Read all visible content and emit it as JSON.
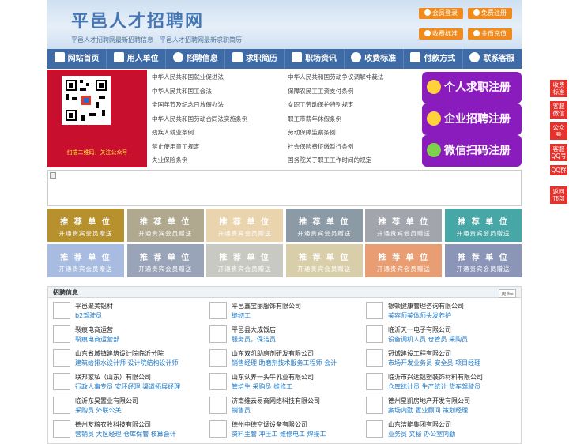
{
  "header": {
    "title": "平邑人才招聘网",
    "subtitle": "平邑人才招聘网最新招聘信息　平邑人才招聘网最新求职简历",
    "buttons": [
      "会员登录",
      "免费注册",
      "收费标准",
      "金币充值"
    ]
  },
  "nav": [
    "网站首页",
    "用人单位",
    "招聘信息",
    "求职简历",
    "职场资讯",
    "收费标准",
    "付款方式",
    "联系客服"
  ],
  "qr": {
    "caption": "扫描二维码，关注公众号"
  },
  "law_links": [
    "中华人民共和国就业促进法",
    "中华人民共和国劳动争议调解仲裁法",
    "中华人民共和国工会法",
    "保障农民工工资支付条例",
    "全国年节及纪念日放假办法",
    "女职工劳动保护特别规定",
    "中华人民共和国劳动合同法实施条例",
    "职工带薪年休假条例",
    "残疾人就业条例",
    "劳动保障监察条例",
    "禁止使用童工规定",
    "社会保险费征缴暂行条例",
    "失业保险条例",
    "国务院关于职工工作时间的规定"
  ],
  "register": [
    "个人求职注册",
    "企业招聘注册",
    "微信扫码注册"
  ],
  "tiles": {
    "title": "推 荐 单 位",
    "caption": "开通贵宾会员赠送",
    "colors": [
      "#b8912f",
      "#b0a990",
      "#e9d4ae",
      "#8c9aa6",
      "#a3a5ad",
      "#47a6a6",
      "#a7bce0",
      "#9aa4b8",
      "#c9c9c4",
      "#d8cfaa",
      "#e89e72",
      "#8b95b8"
    ]
  },
  "jobs": {
    "title": "招聘信息",
    "more": "更多»",
    "list": [
      {
        "company": "平邑聚美铝材",
        "jobs": "b2驾驶员"
      },
      {
        "company": "平邑鑫宝丽服饰有限公司",
        "jobs": "缝纫工"
      },
      {
        "company": "银顿健康管理咨询有限公司",
        "jobs": "美容师美体师头发养护"
      },
      {
        "company": "裂痕电商运营",
        "jobs": "裂痕电商运营部"
      },
      {
        "company": "平邑县大成饭店",
        "jobs": "服务员，保洁员"
      },
      {
        "company": "临沂天一电子有限公司",
        "jobs": "设备调机人员 仓管员 采购员"
      },
      {
        "company": "山东省城镇建筑设计院临沂分院",
        "jobs": "建筑给排水设计师 设计院结构设计师"
      },
      {
        "company": "山东双凯助磨剂研发有限公司",
        "jobs": "销售经理 助磨剂技术服务工程师 会计"
      },
      {
        "company": "冠诚建设工程有限公司",
        "jobs": "市场开发业务员 安全员 项目经理"
      },
      {
        "company": "联邦家私（山东）有限公司",
        "jobs": "行政人事专员 安环经理 渠道拓展经理"
      },
      {
        "company": "山东认养一头牛乳业有限公司",
        "jobs": "管培生 采购员 维修工"
      },
      {
        "company": "临沂市兴达铝塑装饰材料有限公司",
        "jobs": "仓库统计员 生产统计 货车驾驶员"
      },
      {
        "company": "临沂东昊置业有限公司",
        "jobs": "采购员 外联公关"
      },
      {
        "company": "济南维云易商网络科技有限公司",
        "jobs": "销售员"
      },
      {
        "company": "德州星凯房地产开发有限公司",
        "jobs": "案场内勤 置业顾问 策划经理"
      },
      {
        "company": "德州友粮农牧科技有限公司",
        "jobs": "营销员 大区经理 仓库保管 核算会计"
      },
      {
        "company": "德州中德空调设备有限公司",
        "jobs": "资料主管 冲压工 维修电工 焊接工"
      },
      {
        "company": "山东洁能集团有限公司",
        "jobs": "业务员 文秘 办公室内勤"
      }
    ]
  },
  "side": [
    "收费标准",
    "客服微信",
    "公众号",
    "客服QQ号",
    "QQ群",
    "返回顶部"
  ]
}
